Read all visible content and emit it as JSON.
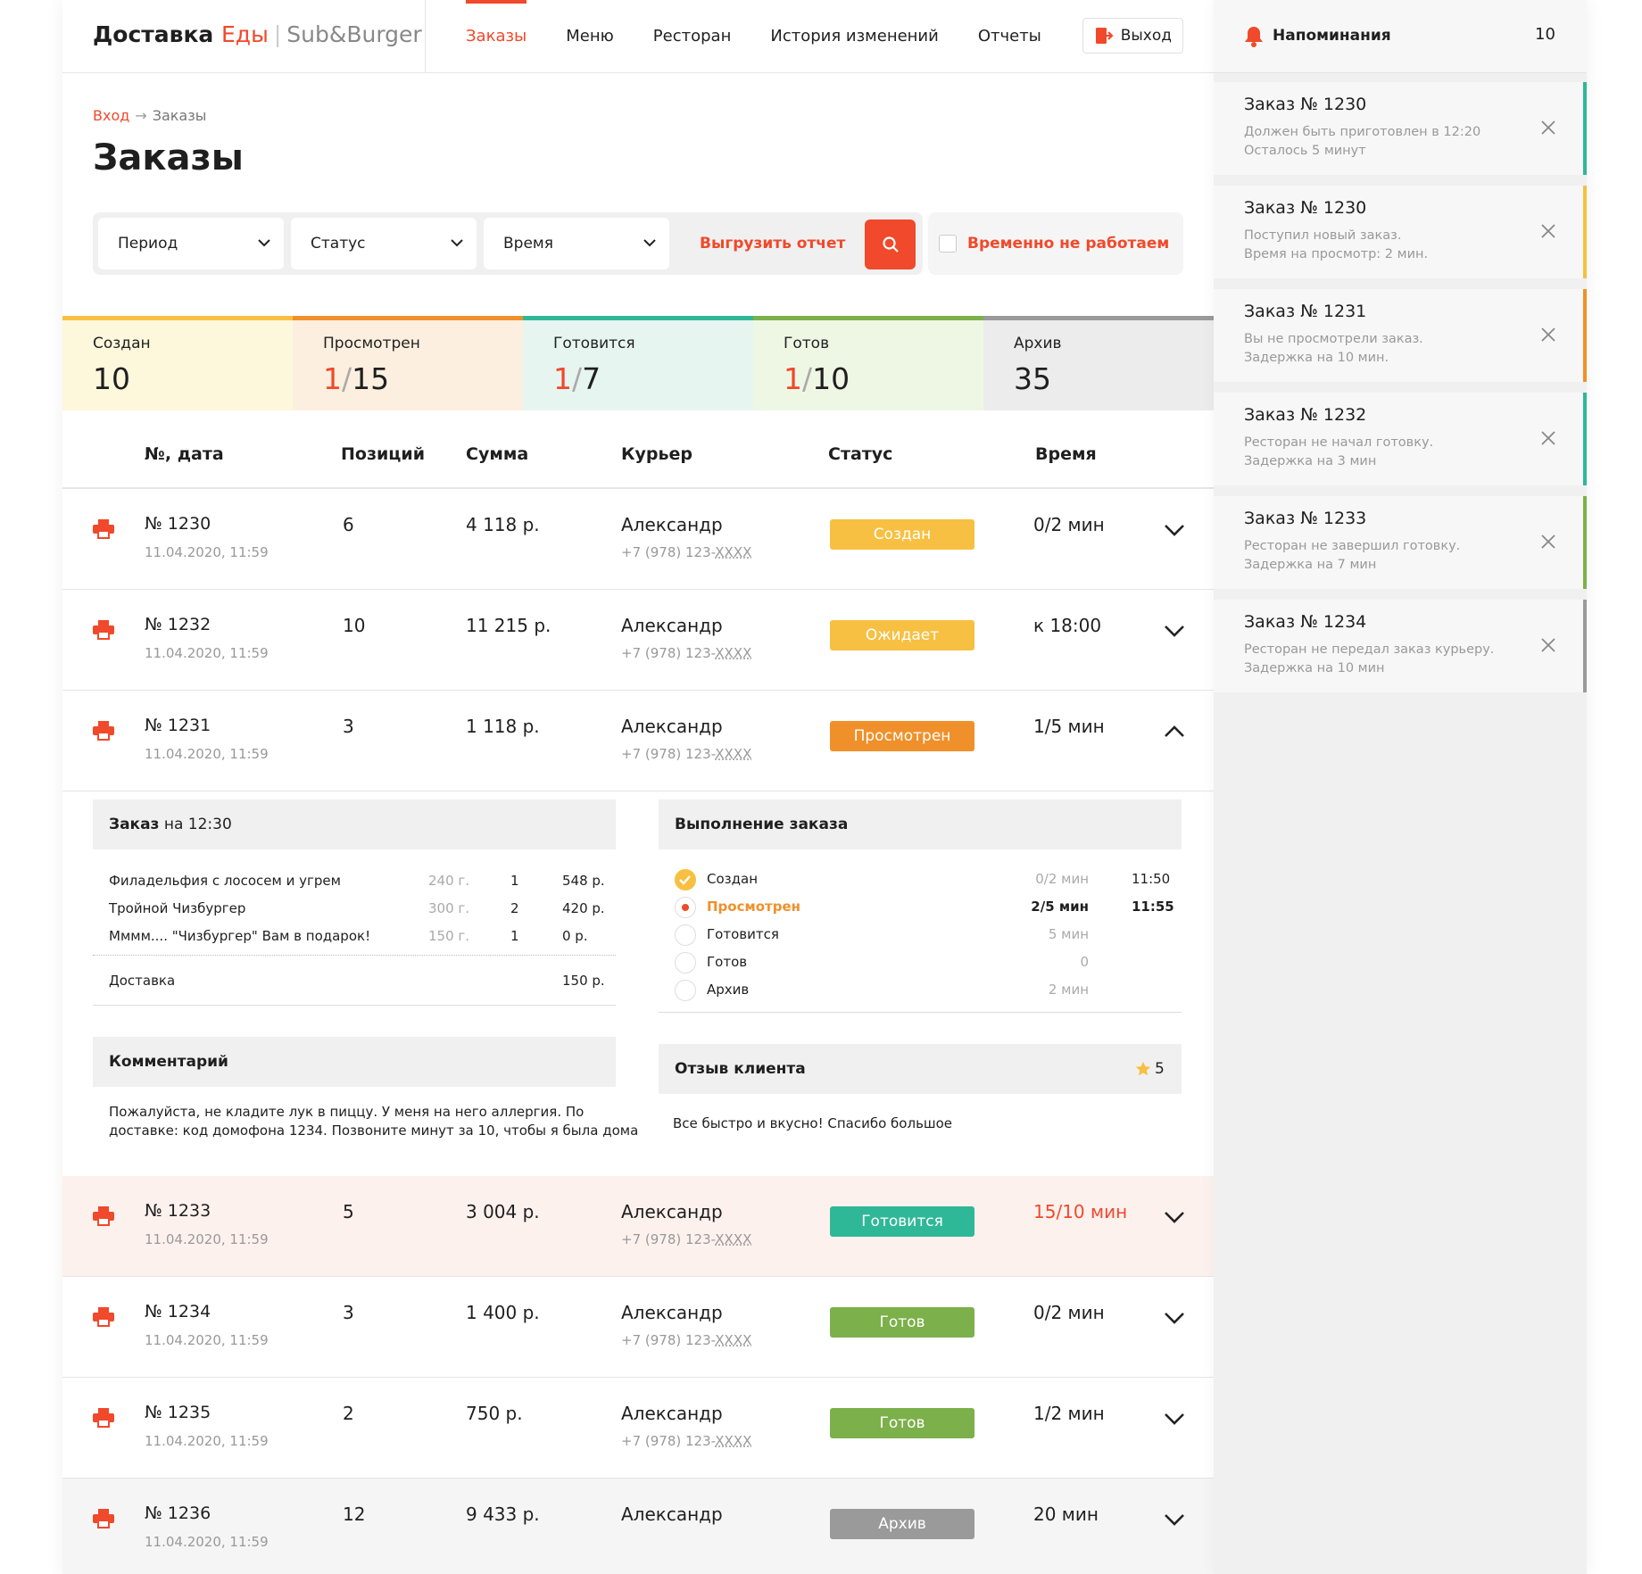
{
  "header": {
    "brand_main": "Доставка",
    "brand_red": "Еды",
    "brand_sep": "|",
    "brand_sub": "Sub&Burger",
    "nav": [
      "Заказы",
      "Меню",
      "Ресторан",
      "История изменений",
      "Отчеты"
    ],
    "logout": "Выход"
  },
  "breadcrumb": {
    "home": "Вход",
    "arrow": "→",
    "current": "Заказы"
  },
  "title": "Заказы",
  "filters": {
    "period": "Период",
    "status": "Статус",
    "time": "Время",
    "export": "Выгрузить отчет",
    "closed": "Временно не работаем"
  },
  "stats": [
    {
      "label": "Создан",
      "a": "",
      "sep": "",
      "b": "10",
      "color": "#f7c042",
      "bg": "#fdf7dc"
    },
    {
      "label": "Просмотрен",
      "a": "1",
      "sep": "/",
      "b": "15",
      "color": "#f0902a",
      "bg": "#fdefdf"
    },
    {
      "label": "Готовится",
      "a": "1",
      "sep": "/",
      "b": "7",
      "color": "#2fb897",
      "bg": "#e7f5f1"
    },
    {
      "label": "Готов",
      "a": "1",
      "sep": "/",
      "b": "10",
      "color": "#7cb04a",
      "bg": "#eef7e4"
    },
    {
      "label": "Архив",
      "a": "",
      "sep": "",
      "b": "35",
      "color": "#9a9a9a",
      "bg": "#ececec"
    }
  ],
  "table": {
    "headers": [
      "№, дата",
      "Позиций",
      "Сумма",
      "Курьер",
      "Статус",
      "Время"
    ],
    "rows": [
      {
        "no": "№ 1230",
        "date": "11.04.2020, 11:59",
        "pos": "6",
        "sum": "4 118 р.",
        "courier": "Александр",
        "phone_a": "+7 (978) 123-",
        "phone_b": "XXXX",
        "status": "Создан",
        "status_color": "#f7c042",
        "time": "0/2 мин",
        "time_color": "#1f1f1f",
        "bg": "#ffffff"
      },
      {
        "no": "№ 1232",
        "date": "11.04.2020, 11:59",
        "pos": "10",
        "sum": "11 215 р.",
        "courier": "Александр",
        "phone_a": "+7 (978) 123-",
        "phone_b": "XXXX",
        "status": "Ожидает",
        "status_color": "#f7c042",
        "time": "к 18:00",
        "time_color": "#1f1f1f",
        "bg": "#ffffff"
      },
      {
        "no": "№ 1231",
        "date": "11.04.2020, 11:59",
        "pos": "3",
        "sum": "1 118 р.",
        "courier": "Александр",
        "phone_a": "+7 (978) 123-",
        "phone_b": "XXXX",
        "status": "Просмотрен",
        "status_color": "#f0902a",
        "time": "1/5 мин",
        "time_color": "#1f1f1f",
        "bg": "#ffffff"
      },
      {
        "no": "№ 1233",
        "date": "11.04.2020, 11:59",
        "pos": "5",
        "sum": "3 004 р.",
        "courier": "Александр",
        "phone_a": "+7 (978) 123-",
        "phone_b": "XXXX",
        "status": "Готовится",
        "status_color": "#2fb897",
        "time": "15/10 мин",
        "time_color": "#f0492b",
        "bg": "#fdf1ee"
      },
      {
        "no": "№ 1234",
        "date": "11.04.2020, 11:59",
        "pos": "3",
        "sum": "1 400 р.",
        "courier": "Александр",
        "phone_a": "+7 (978) 123-",
        "phone_b": "XXXX",
        "status": "Готов",
        "status_color": "#7cb04a",
        "time": "0/2 мин",
        "time_color": "#1f1f1f",
        "bg": "#ffffff"
      },
      {
        "no": "№ 1235",
        "date": "11.04.2020, 11:59",
        "pos": "2",
        "sum": "750 р.",
        "courier": "Александр",
        "phone_a": "+7 (978) 123-",
        "phone_b": "XXXX",
        "status": "Готов",
        "status_color": "#7cb04a",
        "time": "1/2 мин",
        "time_color": "#1f1f1f",
        "bg": "#ffffff"
      },
      {
        "no": "№ 1236",
        "date": "11.04.2020, 11:59",
        "pos": "12",
        "sum": "9 433 р.",
        "courier": "Александр",
        "phone_a": "",
        "phone_b": "",
        "status": "Архив",
        "status_color": "#9a9a9a",
        "time": "20 мин",
        "time_color": "#1f1f1f",
        "bg": "#f5f5f5"
      }
    ]
  },
  "detail": {
    "order_title_b": "Заказ",
    "order_title_r": "на 12:30",
    "items": [
      {
        "name": "Филадельфия с лососем и угрем",
        "weight": "240 г.",
        "qty": "1",
        "price": "548 р."
      },
      {
        "name": "Тройной Чизбургер",
        "weight": "300 г.",
        "qty": "2",
        "price": "420 р."
      },
      {
        "name": "Мммм.... \"Чизбургер\" Вам в подарок!",
        "weight": "150 г.",
        "qty": "1",
        "price": "0 р."
      }
    ],
    "delivery_label": "Доставка",
    "delivery_price": "150 р.",
    "comment_title": "Комментарий",
    "comment_l1": "Пожалуйста, не кладите лук в пиццу. У меня на него аллергия. По",
    "comment_l2": "доставке: код домофона 1234. Позвоните минут за 10, чтобы я была дома",
    "progress_title": "Выполнение заказа",
    "steps": [
      {
        "label": "Создан",
        "dur": "0/2 мин",
        "time": "11:50"
      },
      {
        "label": "Просмотрен",
        "dur": "2/5 мин",
        "time": "11:55"
      },
      {
        "label": "Готовится",
        "dur": "5 мин",
        "time": ""
      },
      {
        "label": "Готов",
        "dur": "0",
        "time": ""
      },
      {
        "label": "Архив",
        "dur": "2 мин",
        "time": ""
      }
    ],
    "review_title": "Отзыв клиента",
    "review_rating": "5",
    "review_text": "Все быстро и вкусно! Спасибо большое"
  },
  "reminders": {
    "title": "Напоминания",
    "count": "10",
    "items": [
      {
        "title": "Заказ № 1230",
        "text": "Должен быть приготовлен  в 12:20\nОсталось 5 минут",
        "color": "#2fb897"
      },
      {
        "title": "Заказ № 1230",
        "text": "Поступил новый заказ.\nВремя на просмотр: 2 мин.",
        "color": "#f7c042"
      },
      {
        "title": "Заказ № 1231",
        "text": "Вы не просмотрели заказ.\nЗадержка на 10 мин.",
        "color": "#f0902a"
      },
      {
        "title": "Заказ № 1232",
        "text": "Ресторан не начал готовку.\nЗадержка на 3 мин",
        "color": "#2fb897"
      },
      {
        "title": "Заказ № 1233",
        "text": "Ресторан не завершил готовку.\nЗадержка на 7 мин",
        "color": "#7cb04a"
      },
      {
        "title": "Заказ № 1234",
        "text": "Ресторан не передал заказ курьеру.\nЗадержка на 10 мин",
        "color": "#9a9a9a"
      }
    ]
  },
  "icons": [
    "printer-icon",
    "chevron-down-icon",
    "chevron-up-icon",
    "search-icon",
    "bell-icon",
    "close-icon",
    "logout-icon",
    "star-icon",
    "check-icon"
  ],
  "colors": {
    "accent": "#f0492b"
  }
}
